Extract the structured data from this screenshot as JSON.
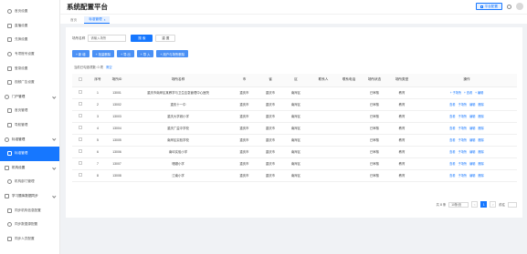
{
  "app": {
    "title": "系统配置平台"
  },
  "header": {
    "platform_btn": "平台配置"
  },
  "sidebar": {
    "items": [
      {
        "label": "首页设置",
        "type": "child"
      },
      {
        "label": "直播设置",
        "type": "child"
      },
      {
        "label": "兑换设置",
        "type": "child"
      },
      {
        "label": "专项账号设置",
        "type": "child"
      },
      {
        "label": "登录设置",
        "type": "child"
      },
      {
        "label": "视频广告设置",
        "type": "child"
      },
      {
        "label": "门户管理",
        "type": "group"
      },
      {
        "label": "首页管理",
        "type": "child"
      },
      {
        "label": "导航管理",
        "type": "child"
      },
      {
        "label": "标准管理",
        "type": "group"
      },
      {
        "label": "标准管理",
        "type": "active"
      },
      {
        "label": "机构设置",
        "type": "group"
      },
      {
        "label": "机构部门管理",
        "type": "child"
      },
      {
        "label": "学习题库数据同步",
        "type": "group"
      },
      {
        "label": "同步机构信息配置",
        "type": "child"
      },
      {
        "label": "同步数据源配置",
        "type": "child"
      },
      {
        "label": "同步人员配置",
        "type": "child"
      }
    ]
  },
  "tabs": [
    {
      "label": "首页",
      "active": false
    },
    {
      "label": "标准管理",
      "active": true
    }
  ],
  "search": {
    "label": "场所名称",
    "placeholder": "请输入场所",
    "query_label": "搜 索",
    "reset_label": "重 置"
  },
  "actions": [
    "+ 新 增",
    "+ 批量删除",
    "+ 导 出",
    "+ 导 入",
    "+ 用户与场所删除"
  ],
  "selection": {
    "text": "当前已勾选项数: 0 项",
    "clear": "清空"
  },
  "table": {
    "columns": [
      "",
      "序号",
      "场所ID",
      "场所名称",
      "市",
      "省",
      "区",
      "联系人",
      "联系电话",
      "场所状态",
      "场所类型",
      "操作"
    ],
    "rows": [
      {
        "idx": "1",
        "id": "13001",
        "name": "重庆市南岸区某教学与卫生应急管理中心医院",
        "city": "重庆市",
        "prov": "重庆市",
        "dist": "南岸区",
        "contact": "",
        "phone": "",
        "status": "已审核",
        "type": "教育",
        "ops": [
          "+ 子场所",
          "+ 查看",
          "+ 编辑"
        ]
      },
      {
        "idx": "2",
        "id": "13002",
        "name": "重庆十一中",
        "city": "重庆市",
        "prov": "重庆市",
        "dist": "南岸区",
        "contact": "",
        "phone": "",
        "status": "已审核",
        "type": "教育",
        "ops": [
          "查看",
          "子场所",
          "编辑",
          "删除"
        ]
      },
      {
        "idx": "3",
        "id": "13003",
        "name": "重庆大学城小学",
        "city": "重庆市",
        "prov": "重庆市",
        "dist": "南岸区",
        "contact": "",
        "phone": "",
        "status": "已审核",
        "type": "教育",
        "ops": [
          "查看",
          "子场所",
          "编辑",
          "删除"
        ]
      },
      {
        "idx": "4",
        "id": "13004",
        "name": "重庆广益中学校",
        "city": "重庆市",
        "prov": "重庆市",
        "dist": "南岸区",
        "contact": "",
        "phone": "",
        "status": "已审核",
        "type": "教育",
        "ops": [
          "查看",
          "子场所",
          "编辑",
          "删除"
        ]
      },
      {
        "idx": "5",
        "id": "13005",
        "name": "南岸区实验学校",
        "city": "重庆市",
        "prov": "重庆市",
        "dist": "南岸区",
        "contact": "",
        "phone": "",
        "status": "已审核",
        "type": "教育",
        "ops": [
          "查看",
          "子场所",
          "编辑",
          "删除"
        ]
      },
      {
        "idx": "6",
        "id": "13006",
        "name": "南坪实验小学",
        "city": "重庆市",
        "prov": "重庆市",
        "dist": "南岸区",
        "contact": "",
        "phone": "",
        "status": "已审核",
        "type": "教育",
        "ops": [
          "查看",
          "子场所",
          "编辑",
          "删除"
        ]
      },
      {
        "idx": "7",
        "id": "13007",
        "name": "珊瑚小学",
        "city": "重庆市",
        "prov": "重庆市",
        "dist": "南岸区",
        "contact": "",
        "phone": "",
        "status": "已审核",
        "type": "教育",
        "ops": [
          "查看",
          "子场所",
          "编辑",
          "删除"
        ]
      },
      {
        "idx": "8",
        "id": "13008",
        "name": "江南小学",
        "city": "重庆市",
        "prov": "重庆市",
        "dist": "南岸区",
        "contact": "",
        "phone": "",
        "status": "已审核",
        "type": "教育",
        "ops": [
          "查看",
          "子场所",
          "编辑",
          "删除"
        ]
      }
    ]
  },
  "pager": {
    "total": "共 8 条",
    "size": "10条/页",
    "prev": "<",
    "current": "1",
    "next": ">",
    "jump_label": "前往"
  },
  "colors": {
    "accent": "#1677ff",
    "active_bg": "#1677ff",
    "action_btn": "#4a90f5"
  }
}
